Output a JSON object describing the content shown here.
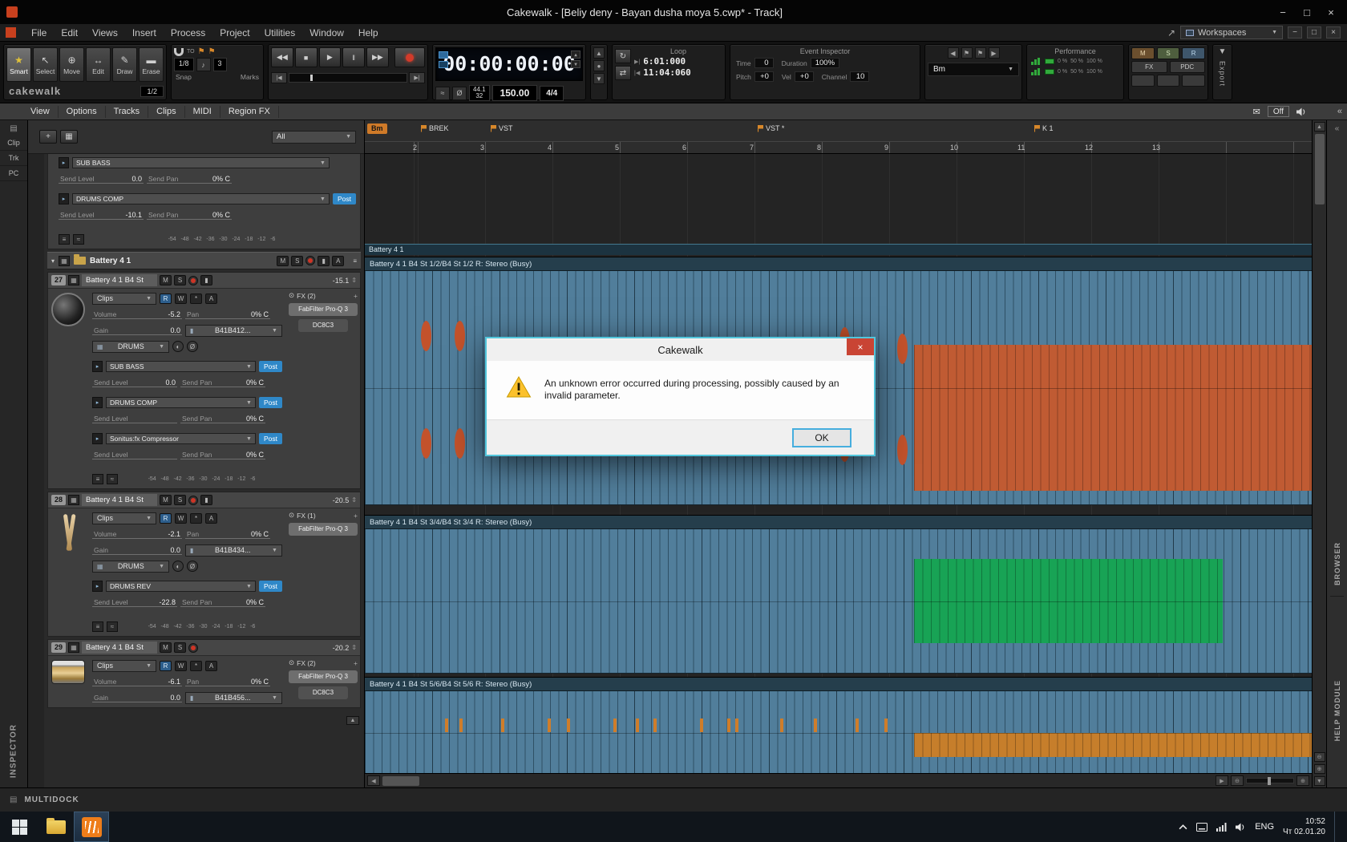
{
  "colors": {
    "post_blue": "#2f88c8",
    "clip_blue": "#517e9b",
    "clip_orange": "#c05b33",
    "clip_green": "#18a355",
    "clip_amber": "#c67e2b",
    "dialog_border": "#52c6dc",
    "record_red": "#cc3526"
  },
  "titlebar": {
    "title": "Cakewalk - [Beliy deny  -  Bayan  dusha moya   5.cwp* - Track]",
    "minimize": "−",
    "maximize": "□",
    "close": "×"
  },
  "menubar": {
    "items": [
      "File",
      "Edit",
      "Views",
      "Insert",
      "Process",
      "Project",
      "Utilities",
      "Window",
      "Help"
    ],
    "workspaces": "Workspaces"
  },
  "tools": {
    "smart": "Smart",
    "select": "Select",
    "move": "Move",
    "edit": "Edit",
    "draw": "Draw",
    "erase": "Erase",
    "brand": "cakewalk",
    "ratio": "1/2"
  },
  "snap": {
    "label": "Snap",
    "to": "TO",
    "res": "1/8",
    "count": "3",
    "marks": "Marks"
  },
  "transport": {
    "time": "00:00:00:00",
    "rate": "44.1",
    "depth": "32",
    "tempo": "150.00",
    "meter": "4/4"
  },
  "loop": {
    "title": "Loop",
    "start": "6:01:000",
    "end": "11:04:060"
  },
  "event_inspector": {
    "title": "Event Inspector",
    "time_label": "Time",
    "time_value": "0",
    "duration_label": "Duration",
    "duration_value": "100%",
    "pitch_label": "Pitch",
    "pitch_value": "+0",
    "vel_label": "Vel",
    "vel_value": "+0",
    "channel_label": "Channel",
    "channel_value": "10",
    "key": "Bm"
  },
  "performance": {
    "title": "Performance",
    "p0": "0 %",
    "p50": "50 %",
    "p100": "100 %"
  },
  "mix": {
    "m": "M",
    "s": "S",
    "r": "R",
    "fx": "FX",
    "pdc": "PDC"
  },
  "export": {
    "label": "Export"
  },
  "ribbon": {
    "items": [
      "View",
      "Options",
      "Tracks",
      "Clips",
      "MIDI",
      "Region FX"
    ],
    "off": "Off"
  },
  "left_dock": {
    "tab_clip": "Clip",
    "tab_trk": "Trk",
    "tab_pc": "PC",
    "inspector": "INSPECTOR"
  },
  "track_panel": {
    "filter": "All"
  },
  "labels": {
    "send_level": "Send Level",
    "send_pan": "Send Pan",
    "post": "Post",
    "volume": "Volume",
    "pan": "Pan",
    "gain": "Gain",
    "clips": "Clips",
    "m": "M",
    "s": "S",
    "r": "R",
    "w": "W",
    "a": "A",
    "scale": "-54   -48   -42   -36   -30   -24   -18   -12   -6"
  },
  "top_sends": {
    "send1_name": "SUB  BASS",
    "send1_level": "0.0",
    "send1_pan": "0% C",
    "send2_name": "DRUMS  COMP",
    "send2_level": "-10.1",
    "send2_pan": "0% C"
  },
  "folder": {
    "name": "Battery 4 1"
  },
  "track27": {
    "num": "27",
    "name": "Battery 4 1 B4 St",
    "peak": "-15.1",
    "volume": "-5.2",
    "pan": "0% C",
    "gain": "0.0",
    "bank": "B41B412...",
    "output": "DRUMS",
    "fx_title": "FX (2)",
    "fx1": "FabFilter Pro-Q 3",
    "fx2": "DC8C3",
    "send1_name": "SUB  BASS",
    "send1_level": "0.0",
    "send1_pan": "0% C",
    "send2_name": "DRUMS  COMP",
    "send2_level": "",
    "send2_pan": "0% C",
    "send3_name": "Sonitus:fx Compressor",
    "send3_level": "",
    "send3_pan": "0% C"
  },
  "track28": {
    "num": "28",
    "name": "Battery 4 1 B4 St",
    "peak": "-20.5",
    "volume": "-2.1",
    "pan": "0% C",
    "gain": "0.0",
    "bank": "B41B434...",
    "output": "DRUMS",
    "fx_title": "FX (1)",
    "fx1": "FabFilter Pro-Q 3",
    "send1_name": "DRUMS  REV",
    "send1_level": "-22.8",
    "send1_pan": "0% C"
  },
  "track29": {
    "num": "29",
    "name": "Battery 4 1 B4 St",
    "peak": "-20.2",
    "volume": "-6.1",
    "pan": "0% C",
    "gain": "0.0",
    "bank": "B41B456...",
    "fx_title": "FX (2)",
    "fx1": "FabFilter Pro-Q 3",
    "fx2": "DC8C3"
  },
  "ruler": {
    "key": "Bm",
    "m1": "BREK",
    "m2": "VST",
    "m3": "VST *",
    "m4": "K 1",
    "n2": "2",
    "n3": "3",
    "n4": "4",
    "n5": "5",
    "n6": "6",
    "n7": "7",
    "n8": "8",
    "n9": "9",
    "n10": "10",
    "n11": "11",
    "n12": "12",
    "n13": "13"
  },
  "clips": {
    "folder_label": "Battery 4 1",
    "row1_label": "Battery 4 1 B4 St 1/2/B4 St 1/2 R: Stereo (Busy)",
    "row2_label": "Battery 4 1 B4 St 3/4/B4 St 3/4 R: Stereo (Busy)",
    "row3_label": "Battery 4 1 B4 St 5/6/B4 St 5/6 R: Stereo (Busy)"
  },
  "dialog": {
    "title": "Cakewalk",
    "line1": "An unknown error occurred during processing, possibly caused by an",
    "line2": "invalid parameter.",
    "ok": "OK"
  },
  "right_dock": {
    "browser": "BROWSER",
    "help": "HELP MODULE"
  },
  "multidock": {
    "label": "MULTIDOCK"
  },
  "taskbar": {
    "lang": "ENG",
    "time": "10:52",
    "date": "Чт 02.01.20"
  }
}
